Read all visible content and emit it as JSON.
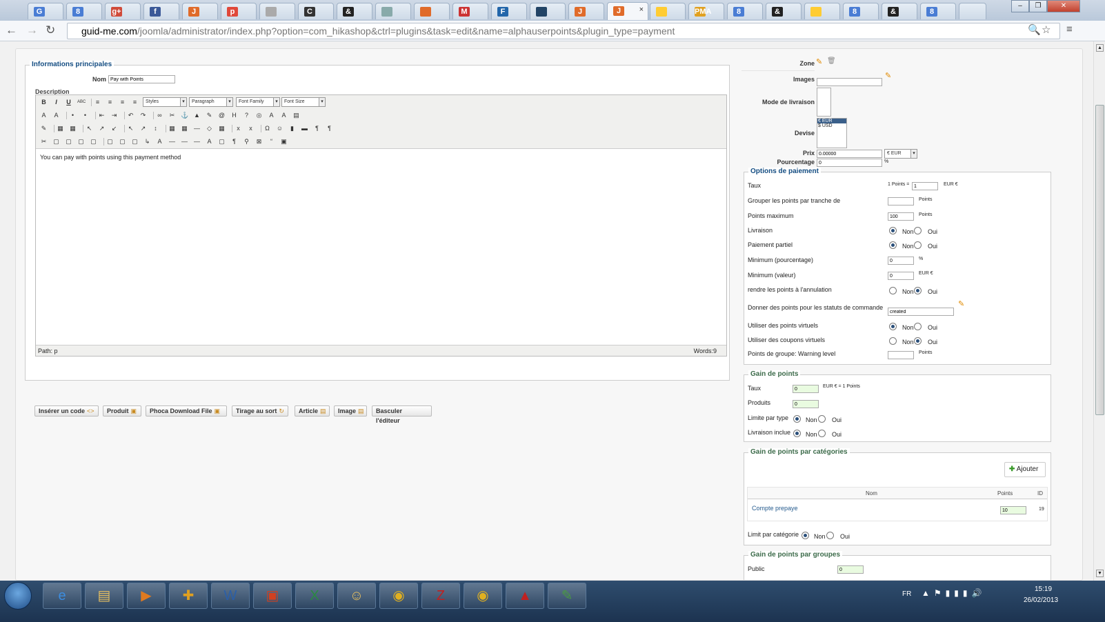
{
  "browser": {
    "tabs": [
      "G",
      "8",
      "g+",
      "f",
      "J",
      "p",
      "",
      "C",
      "&",
      "",
      "",
      "M",
      "F",
      "",
      "J",
      "J",
      "",
      "PMA",
      "8",
      "&",
      "",
      "8",
      "&",
      "8"
    ],
    "active_tab_close": "×",
    "url_host": "guid-me.com",
    "url_path": "/joomla/administrator/index.php?option=com_hikashop&ctrl=plugins&task=edit&name=alphauserpoints&plugin_type=payment",
    "window_buttons": [
      "–",
      "❐",
      "✕"
    ]
  },
  "main": {
    "legend": "Informations principales",
    "nom_label": "Nom",
    "nom_value": "Pay with Points",
    "description_label": "Description",
    "toolbar_selects": [
      "Styles",
      "Paragraph",
      "Font Family",
      "Font Size"
    ],
    "editor_text": "You can pay with points using this payment method",
    "path": "Path: p",
    "words": "Words:9",
    "buttons": [
      "Insérer un code",
      "Produit",
      "Phoca Download File",
      "Tirage au sort",
      "Article",
      "Image",
      "Basculer l'éditeur"
    ]
  },
  "right": {
    "zone_label": "Zone",
    "images_label": "Images",
    "mode_livraison_label": "Mode de livraison",
    "devise_label": "Devise",
    "devise_options": [
      "€ EUR",
      "$ USD"
    ],
    "prix_label": "Prix",
    "prix_value": "0.00000",
    "prix_currency": "€ EUR",
    "pourcentage_label": "Pourcentage",
    "pourcentage_value": "0",
    "pourcentage_unit": "%"
  },
  "options": {
    "legend": "Options de paiement",
    "taux_label": "Taux",
    "taux_prefix": "1 Points =",
    "taux_value": "1",
    "taux_unit": "EUR €",
    "grouper_label": "Grouper les points par tranche de",
    "grouper_unit": "Points",
    "max_label": "Points maximum",
    "max_value": "100",
    "max_unit": "Points",
    "livraison_label": "Livraison",
    "paiement_partiel_label": "Paiement partiel",
    "min_pct_label": "Minimum (pourcentage)",
    "min_pct_value": "0",
    "min_pct_unit": "%",
    "min_val_label": "Minimum (valeur)",
    "min_val_value": "0",
    "min_val_unit": "EUR €",
    "rendre_label": "rendre les points à l'annulation",
    "donner_label": "Donner des points pour les statuts de commande",
    "donner_value": "created",
    "virtuels_label": "Utiliser des points virtuels",
    "coupons_label": "Utiliser des coupons virtuels",
    "warning_label": "Points de groupe: Warning level",
    "warning_unit": "Points",
    "non": "Non",
    "oui": "Oui"
  },
  "gain": {
    "legend": "Gain de points",
    "taux_label": "Taux",
    "taux_value": "0",
    "taux_unit": "EUR € = 1 Points",
    "produits_label": "Produits",
    "produits_value": "0",
    "limite_label": "Limite par type",
    "livraison_label": "Livraison inclue"
  },
  "gain_cat": {
    "legend": "Gain de points par catégories",
    "ajouter": "Ajouter",
    "columns": [
      "Nom",
      "Points",
      "ID"
    ],
    "rows": [
      {
        "nom": "Compte prepaye",
        "points": "10",
        "id": "19"
      }
    ],
    "limit_label": "Limit par catégorie"
  },
  "gain_groupes": {
    "legend": "Gain de points par groupes",
    "public_label": "Public",
    "public_value": "0"
  },
  "taskbar": {
    "lang": "FR",
    "time": "15:19",
    "date": "26/02/2013"
  },
  "colors": {
    "legend": "#144d82",
    "accent": "#2a4f7a",
    "taskbar": "#1c3350"
  }
}
